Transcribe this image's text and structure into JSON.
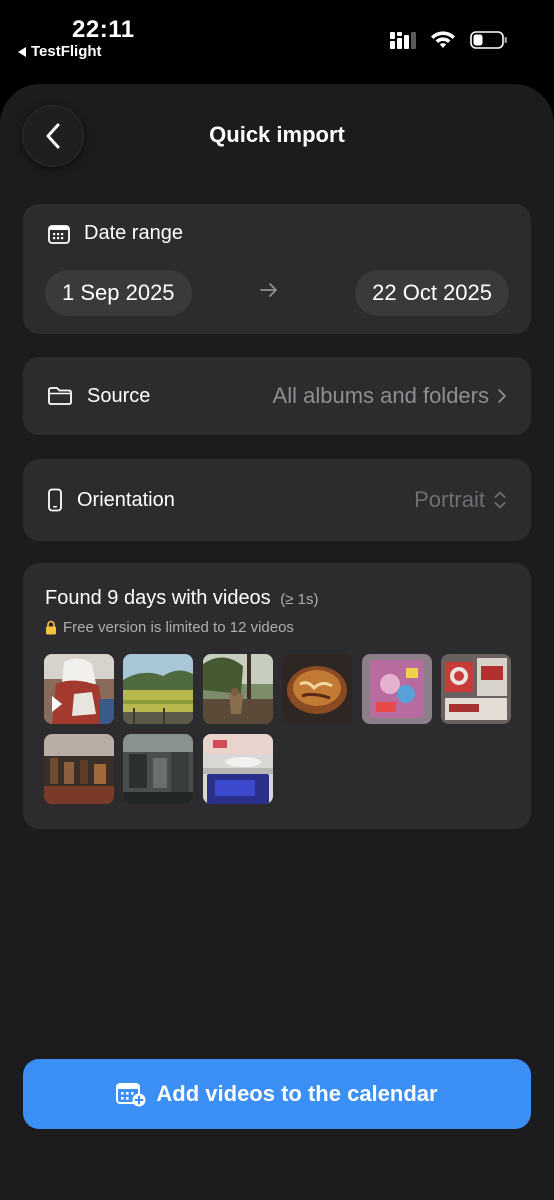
{
  "status_bar": {
    "time": "22:11",
    "back_app": "TestFlight"
  },
  "nav": {
    "title": "Quick import"
  },
  "date_range": {
    "label": "Date range",
    "start": "1 Sep 2025",
    "end": "22 Oct 2025"
  },
  "source": {
    "label": "Source",
    "value": "All albums and folders"
  },
  "orientation": {
    "label": "Orientation",
    "value": "Portrait"
  },
  "found": {
    "title": "Found 9 days with videos",
    "min_duration": "(≥ 1s)",
    "limit_note": "Free version is limited to 12 videos",
    "thumbnails": [
      {
        "name": "video-thumbnail-1"
      },
      {
        "name": "video-thumbnail-2"
      },
      {
        "name": "video-thumbnail-3"
      },
      {
        "name": "video-thumbnail-4"
      },
      {
        "name": "video-thumbnail-5"
      },
      {
        "name": "video-thumbnail-6"
      },
      {
        "name": "video-thumbnail-7"
      },
      {
        "name": "video-thumbnail-8"
      },
      {
        "name": "video-thumbnail-9"
      }
    ]
  },
  "cta": {
    "label": "Add videos to the calendar"
  },
  "colors": {
    "accent": "#3b8ff5",
    "card": "#2c2c2e",
    "sheet": "#1c1c1e",
    "muted": "#8e8e93"
  }
}
